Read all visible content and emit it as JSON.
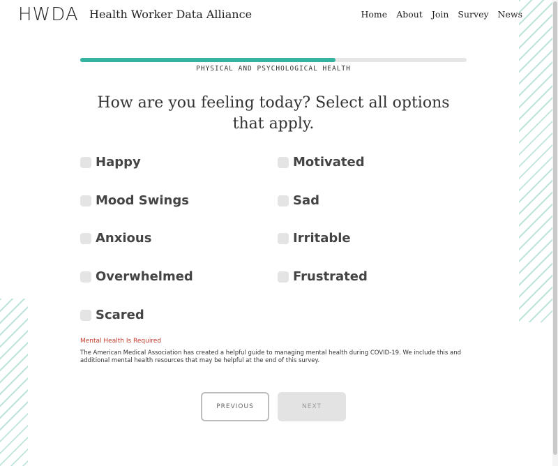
{
  "header": {
    "logo": "HWDA",
    "title": "Health Worker Data Alliance",
    "nav": [
      "Home",
      "About",
      "Join",
      "Survey",
      "News"
    ]
  },
  "progress": {
    "fraction": 0.66,
    "section_label": "PHYSICAL AND PSYCHOLOGICAL HEALTH"
  },
  "question": "How are you feeling today? Select all options that apply.",
  "options": [
    {
      "label": "Happy",
      "checked": false
    },
    {
      "label": "Motivated",
      "checked": false
    },
    {
      "label": "Mood Swings",
      "checked": false
    },
    {
      "label": "Sad",
      "checked": false
    },
    {
      "label": "Anxious",
      "checked": false
    },
    {
      "label": "Irritable",
      "checked": false
    },
    {
      "label": "Overwhelmed",
      "checked": false
    },
    {
      "label": "Frustrated",
      "checked": false
    },
    {
      "label": "Scared",
      "checked": false
    }
  ],
  "error": "Mental Health Is Required",
  "info": "The American Medical Association has created a helpful guide to managing mental health during COVID-19. We include this and additional mental health resources that may be helpful at the end of this survey.",
  "buttons": {
    "previous": "PREVIOUS",
    "next": "NEXT"
  },
  "colors": {
    "accent": "#34b3a0",
    "error": "#c0392b",
    "stripe": "#bfe4dc"
  }
}
